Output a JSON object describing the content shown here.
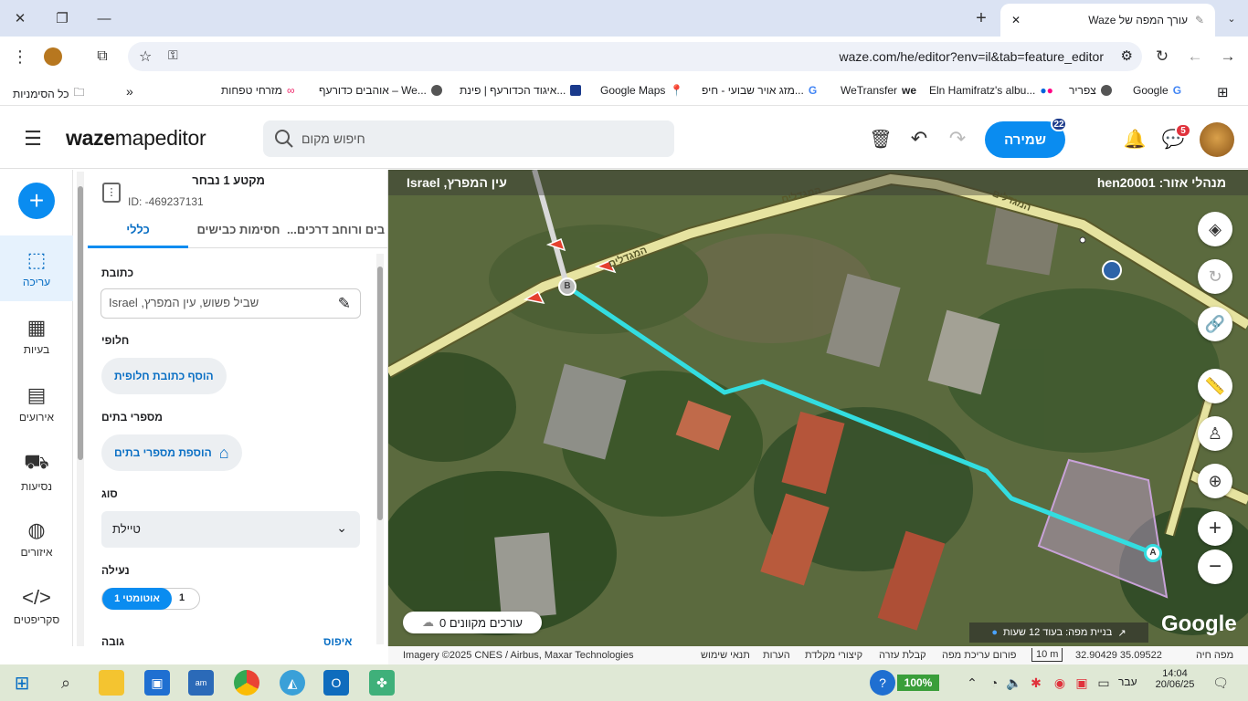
{
  "browser": {
    "tab_title": "עורך המפה של Waze",
    "url": "waze.com/he/editor?env=il&tab=feature_editor",
    "bookmarks": [
      {
        "label": "Google",
        "icon": "google-icon"
      },
      {
        "label": "צפריר",
        "icon": "globe-icon"
      },
      {
        "label": "Eln Hamifratz's albu...",
        "icon": "flickr-icon"
      },
      {
        "label": "WeTransfer",
        "icon": "wetransfer-icon"
      },
      {
        "label": "מזג אויר שבועי - חיפ...",
        "icon": "google-icon"
      },
      {
        "label": "Google Maps",
        "icon": "maps-pin-icon"
      },
      {
        "label": "איגוד הכדורעף | פינת...",
        "icon": "volleyball-icon"
      },
      {
        "label": "אוהבים כדורעף – We...",
        "icon": "globe-icon"
      },
      {
        "label": "מזרחי טפחות",
        "icon": "infinity-icon"
      }
    ],
    "all_bookmarks": "כל הסימניות"
  },
  "header": {
    "logo_bold": "waze",
    "logo_rest": "mapeditor",
    "search_placeholder": "חיפוש מקום",
    "save_label": "שמירה",
    "save_badge": "22",
    "chat_badge": "5"
  },
  "leftnav": {
    "items": [
      {
        "label": "עריכה",
        "icon": "edit-map-icon",
        "active": true
      },
      {
        "label": "בעיות",
        "icon": "issues-icon"
      },
      {
        "label": "אירועים",
        "icon": "calendar-icon"
      },
      {
        "label": "נסיעות",
        "icon": "car-icon"
      },
      {
        "label": "איזורים",
        "icon": "globe-icon"
      },
      {
        "label": "סקריפטים",
        "icon": "code-icon"
      }
    ]
  },
  "panel": {
    "title": "מקטע 1 נבחר",
    "id": "ID: -469237131",
    "tabs": [
      "כללי",
      "חסימות כבישים",
      "...בים ורוחב דרכים"
    ],
    "address_label": "כתובת",
    "address_value": "שביל פשוש, עין המפרץ, Israel",
    "alt_label": "חלופי",
    "alt_button": "הוסף כתובת חלופית",
    "house_label": "מספרי בתים",
    "house_button": "הוספת מספרי בתים",
    "type_label": "סוג",
    "type_value": "טיילת",
    "lock_label": "נעילה",
    "lock_auto": "אוטומטי 1",
    "lock_value": "1",
    "height_label": "גובה",
    "reset_label": "איפוס"
  },
  "map": {
    "location": "עין המפרץ, Israel",
    "managers": "hen20001 :מנהלי אזור",
    "road_name": "המגדלים",
    "node_a": "A",
    "node_b": "B",
    "online_editors": "עורכים מקוונים 0",
    "build_status": "בניית מפה: בעוד 12 שעות",
    "google": "Google"
  },
  "footer": {
    "imagery": "Imagery ©2025 CNES / Airbus, Maxar Technologies",
    "links": [
      "תנאי שימוש",
      "הערות",
      "קיצורי מקלדת",
      "קבלת עזרה",
      "פורום עריכת מפה"
    ],
    "scale": "10 m",
    "coords": "32.90429 35.09522",
    "live_map": "מפה חיה"
  },
  "taskbar": {
    "battery": "100%",
    "lang": "עבר",
    "time": "14:04",
    "date": "20/06/25"
  },
  "colors": {
    "accent": "#0a8cf0",
    "segment": "#33dde0",
    "road_fill": "#e6e3a0",
    "road_edge": "#5a5a2a",
    "area": "#c8a2d8"
  }
}
